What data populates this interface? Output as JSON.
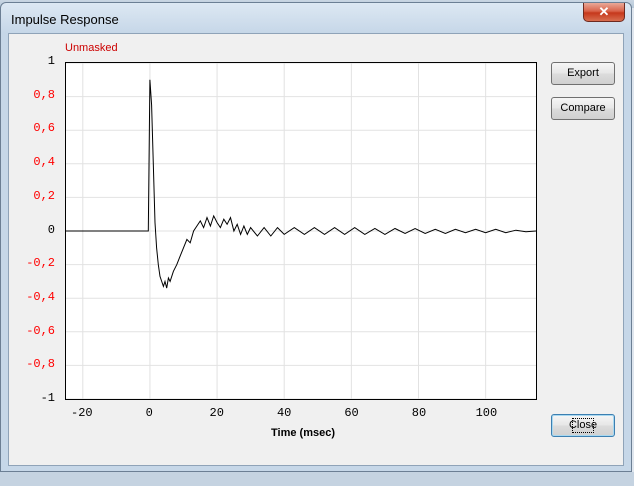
{
  "window": {
    "title": "Impulse Response",
    "close_glyph": "✕"
  },
  "plot": {
    "status_label": "Unmasked",
    "status_color": "#cc0000",
    "y_tick_labels": [
      "1",
      "0,8",
      "0,6",
      "0,4",
      "0,2",
      "0",
      "-0,2",
      "-0,4",
      "-0,6",
      "-0,8",
      "-1"
    ],
    "x_tick_labels": [
      "-20",
      "0",
      "20",
      "40",
      "60",
      "80",
      "100"
    ],
    "xlabel": "Time (msec)"
  },
  "buttons": {
    "export": "Export",
    "compare": "Compare",
    "close": "Close"
  },
  "chart_data": {
    "type": "line",
    "title": "",
    "xlabel": "Time (msec)",
    "ylabel": "",
    "xlim": [
      -25,
      115
    ],
    "ylim": [
      -1,
      1
    ],
    "x_ticks": [
      -20,
      0,
      20,
      40,
      60,
      80,
      100
    ],
    "y_ticks": [
      1,
      0.8,
      0.6,
      0.4,
      0.2,
      0,
      -0.2,
      -0.4,
      -0.6,
      -0.8,
      -1
    ],
    "grid": true,
    "series": [
      {
        "color": "#000000",
        "x": [
          -25,
          -0.5,
          0,
          0.5,
          1,
          1.5,
          2,
          2.5,
          3,
          3.5,
          4,
          4.5,
          5,
          5.5,
          6,
          7,
          8,
          9,
          10,
          11,
          12,
          13,
          14,
          15,
          16,
          17,
          18,
          19,
          20,
          21,
          22,
          23,
          24,
          25,
          26,
          27,
          28,
          29,
          30,
          32,
          34,
          36,
          38,
          40,
          43,
          46,
          49,
          52,
          55,
          58,
          61,
          64,
          67,
          70,
          73,
          76,
          79,
          82,
          85,
          88,
          91,
          94,
          97,
          100,
          103,
          106,
          109,
          112,
          115
        ],
        "y": [
          0,
          0,
          0.9,
          0.75,
          0.4,
          0.05,
          -0.1,
          -0.2,
          -0.27,
          -0.3,
          -0.33,
          -0.3,
          -0.34,
          -0.28,
          -0.3,
          -0.24,
          -0.2,
          -0.15,
          -0.1,
          -0.05,
          -0.07,
          0.0,
          0.03,
          0.06,
          0.02,
          0.08,
          0.03,
          0.09,
          0.05,
          0.02,
          0.07,
          0.04,
          0.08,
          0.0,
          0.04,
          -0.02,
          0.03,
          -0.02,
          0.02,
          -0.03,
          0.02,
          -0.03,
          0.02,
          -0.02,
          0.02,
          -0.02,
          0.02,
          -0.02,
          0.02,
          -0.02,
          0.02,
          -0.02,
          0.015,
          -0.02,
          0.015,
          -0.015,
          0.015,
          -0.015,
          0.01,
          -0.015,
          0.01,
          -0.01,
          0.01,
          -0.01,
          0.01,
          -0.01,
          0.005,
          -0.005,
          0.0
        ]
      }
    ]
  }
}
